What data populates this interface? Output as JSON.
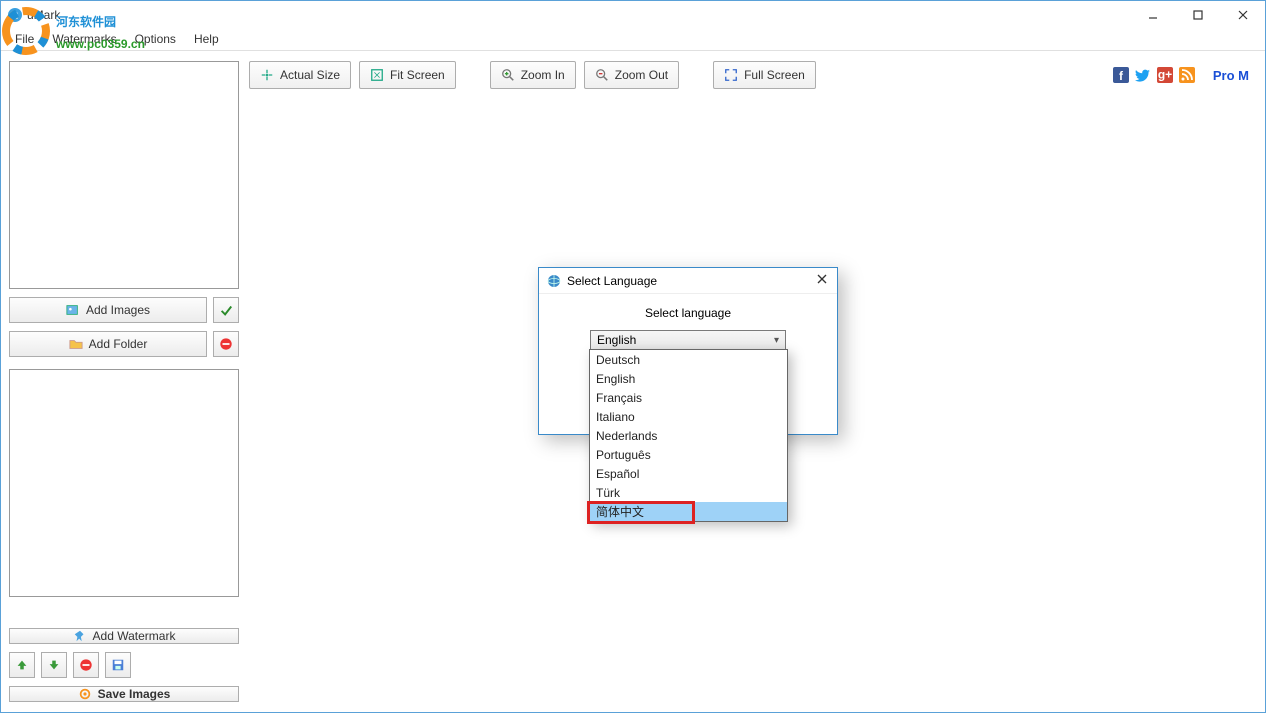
{
  "window": {
    "title": "uMark"
  },
  "watermark_overlay": {
    "text1": "河东软件园",
    "text2": "www.pc0359.cn"
  },
  "menu": {
    "file": "File",
    "watermarks": "Watermarks",
    "options": "Options",
    "help": "Help"
  },
  "left": {
    "add_images": "Add Images",
    "add_folder": "Add Folder",
    "add_watermark": "Add Watermark",
    "save_images": "Save Images"
  },
  "toolbar": {
    "actual_size": "Actual Size",
    "fit_screen": "Fit Screen",
    "zoom_in": "Zoom In",
    "zoom_out": "Zoom Out",
    "full_screen": "Full Screen",
    "pro": "Pro M"
  },
  "dialog": {
    "title": "Select Language",
    "label": "Select language",
    "selected": "English",
    "options": [
      "Deutsch",
      "English",
      "Français",
      "Italiano",
      "Nederlands",
      "Português",
      "Español",
      "Türk",
      "简体中文"
    ]
  }
}
